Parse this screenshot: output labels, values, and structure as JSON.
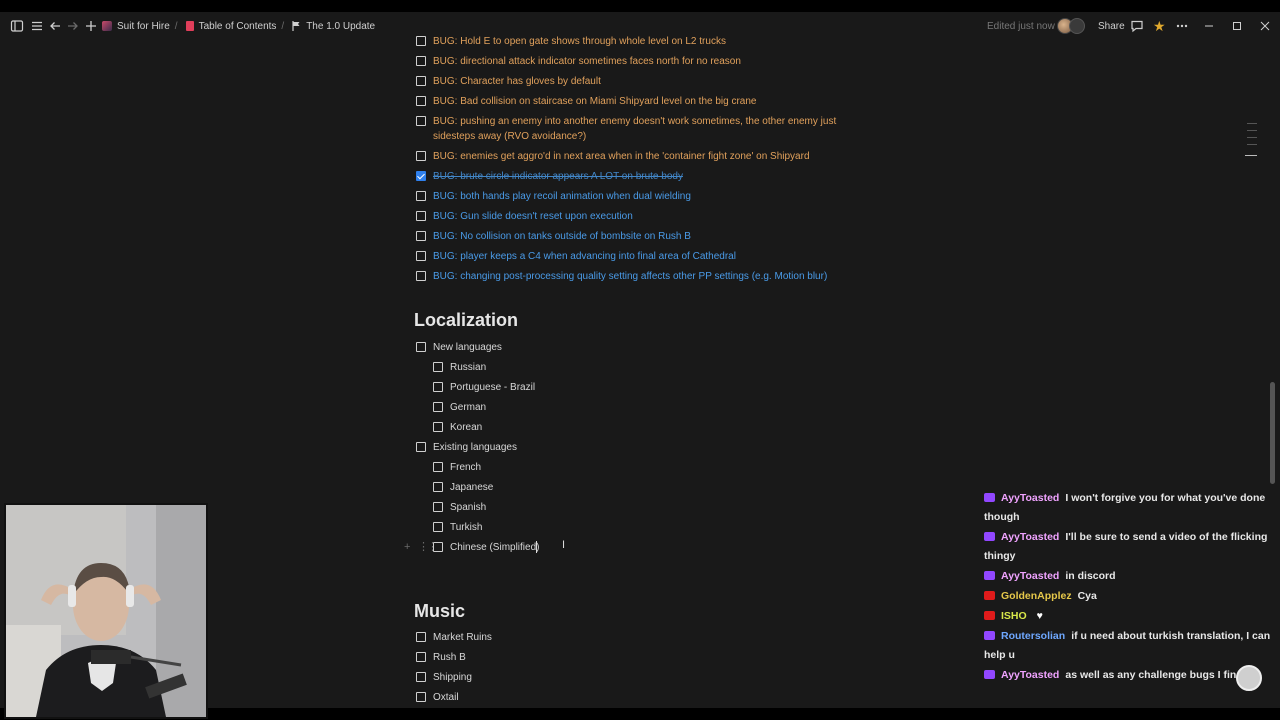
{
  "topbar": {
    "breadcrumbs": [
      "Suit for Hire",
      "Table of Contents",
      "The 1.0 Update"
    ],
    "edited": "Edited just now",
    "share": "Share"
  },
  "bugs": [
    {
      "text": "BUG: Hold E to open gate shows through whole level on L2 trucks",
      "color": "orange",
      "checked": false
    },
    {
      "text": "BUG: directional attack indicator sometimes faces north for no reason",
      "color": "orange",
      "checked": false
    },
    {
      "text": "BUG: Character has gloves by default",
      "color": "orange",
      "checked": false
    },
    {
      "text": "BUG: Bad collision on staircase on Miami Shipyard level on the big crane",
      "color": "orange",
      "checked": false
    },
    {
      "text": "BUG: pushing an enemy into another enemy doesn't work sometimes, the other enemy just",
      "text2": "sidesteps away (RVO avoidance?)",
      "color": "orange",
      "checked": false
    },
    {
      "text": "BUG: enemies get aggro'd in next area when in the 'container fight zone' on Shipyard",
      "color": "orange",
      "checked": false
    },
    {
      "text": "BUG: brute circle indicator appears A LOT on brute body",
      "color": "blue",
      "checked": true
    },
    {
      "text": "BUG: both hands play recoil animation when dual wielding",
      "color": "blue",
      "checked": false
    },
    {
      "text": "BUG: Gun slide doesn't reset upon execution",
      "color": "blue",
      "checked": false
    },
    {
      "text": "BUG: No collision on tanks outside of bombsite on Rush B",
      "color": "blue",
      "checked": false
    },
    {
      "text": "BUG: player keeps a C4 when advancing into final area of Cathedral",
      "color": "blue",
      "checked": false
    },
    {
      "text": "BUG: changing post-processing quality setting affects other PP settings (e.g. Motion blur)",
      "color": "blue",
      "checked": false
    }
  ],
  "localization": {
    "heading": "Localization",
    "new_languages": {
      "label": "New languages",
      "items": [
        "Russian",
        "Portuguese - Brazil",
        "German",
        "Korean"
      ]
    },
    "existing_languages": {
      "label": "Existing languages",
      "items": [
        "French",
        "Japanese",
        "Spanish",
        "Turkish",
        "Chinese (Simplified)"
      ]
    }
  },
  "music": {
    "heading": "Music",
    "items": [
      "Market Ruins",
      "Rush B",
      "Shipping",
      "Oxtail"
    ]
  },
  "chat": [
    {
      "platform": "twitch",
      "user": "AyyToasted",
      "color": "#f0a3ff",
      "text": "I won't forgive you for what you've done though"
    },
    {
      "platform": "twitch",
      "user": "AyyToasted",
      "color": "#f0a3ff",
      "text": "I'll be sure to send a video of the flicking thingy"
    },
    {
      "platform": "twitch",
      "user": "AyyToasted",
      "color": "#f0a3ff",
      "text": "in discord"
    },
    {
      "platform": "youtube",
      "user": "GoldenApplez",
      "color": "#e6c84a",
      "text": "Cya"
    },
    {
      "platform": "youtube",
      "user": "ISHO",
      "color": "#d9e84a",
      "text": ""
    },
    {
      "platform": "twitch",
      "user": "Routersolian",
      "color": "#6fa8ff",
      "text": "if u need about turkish translation, I can help u"
    },
    {
      "platform": "twitch",
      "user": "AyyToasted",
      "color": "#f0a3ff",
      "text": "as well as any challenge bugs I find"
    }
  ],
  "colors": {
    "orange": "#e1a15c",
    "blue": "#4a9be8",
    "background": "#191919"
  }
}
